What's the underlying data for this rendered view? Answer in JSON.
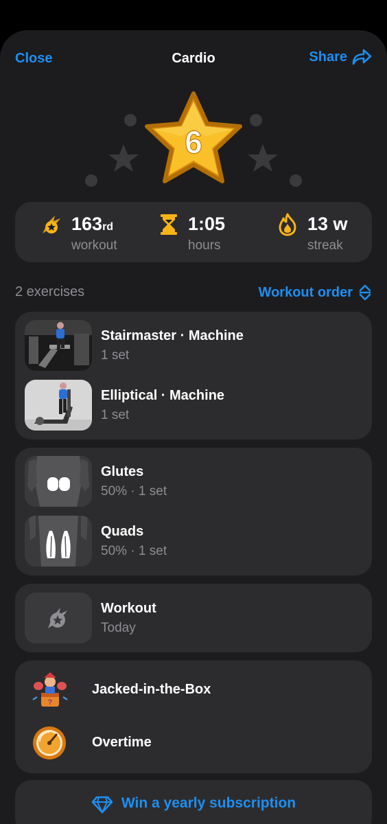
{
  "nav": {
    "close_label": "Close",
    "title": "Cardio",
    "share_label": "Share",
    "share_icon": "share-arrow-icon"
  },
  "hero": {
    "star_number": "6",
    "star_color": "#f7b418"
  },
  "stats": [
    {
      "icon": "meteor-star-icon",
      "value": "163",
      "suffix": "rd",
      "label": "workout"
    },
    {
      "icon": "hourglass-icon",
      "value": "1:05",
      "suffix": "",
      "label": "hours"
    },
    {
      "icon": "flame-icon",
      "value": "13 w",
      "suffix": "",
      "label": "streak"
    }
  ],
  "exercises": {
    "count_label": "2 exercises",
    "order_label": "Workout order",
    "items": [
      {
        "name": "Stairmaster · Machine",
        "sets": "1 set"
      },
      {
        "name": "Elliptical · Machine",
        "sets": "1 set"
      }
    ]
  },
  "muscles": [
    {
      "name": "Glutes",
      "detail": "50% · 1 set"
    },
    {
      "name": "Quads",
      "detail": "50% · 1 set"
    }
  ],
  "workout": {
    "title": "Workout",
    "date": "Today",
    "icon": "meteor-star-icon"
  },
  "achievements": [
    {
      "title": "Jacked-in-the-Box",
      "icon": "jack-in-the-box-badge-icon"
    },
    {
      "title": "Overtime",
      "icon": "stopwatch-badge-icon"
    }
  ],
  "cta": {
    "label": "Win a yearly subscription",
    "icon": "diamond-icon"
  },
  "colors": {
    "accent": "#1e8ff2",
    "background": "#1c1c1e",
    "card": "#2c2c2e",
    "gold": "#f7b418",
    "muted": "#8e8e93"
  }
}
